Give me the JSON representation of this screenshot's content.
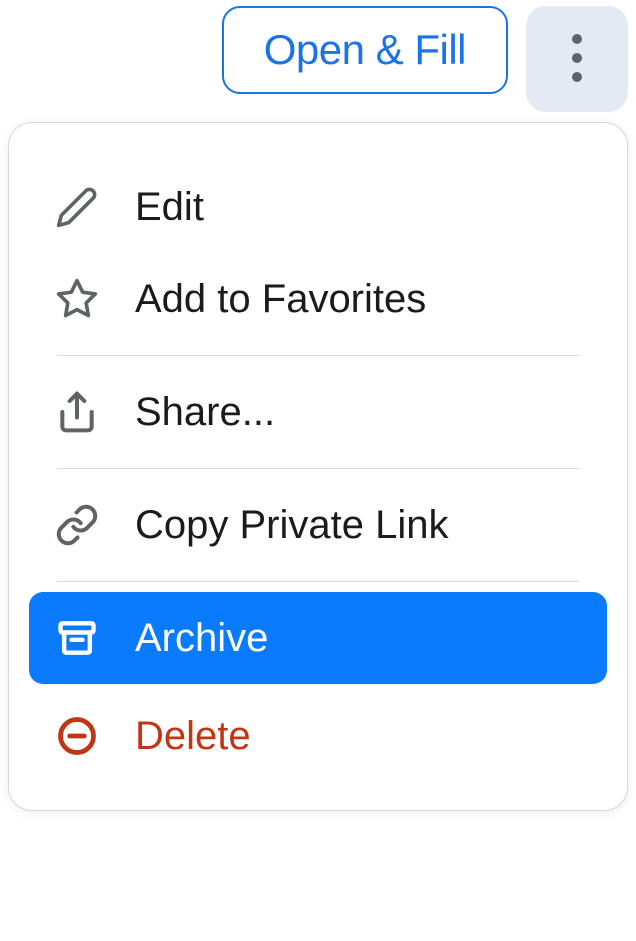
{
  "header": {
    "open_fill_label": "Open & Fill"
  },
  "menu": {
    "edit": "Edit",
    "favorites": "Add to Favorites",
    "share": "Share...",
    "copy_link": "Copy Private Link",
    "archive": "Archive",
    "delete": "Delete"
  }
}
